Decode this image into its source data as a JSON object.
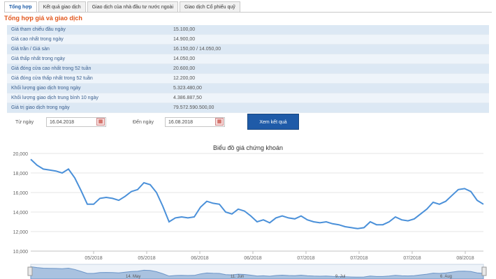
{
  "tabs": [
    {
      "label": "Tổng hợp",
      "active": true
    },
    {
      "label": "Kết quả giao dịch",
      "active": false
    },
    {
      "label": "Giao dịch của nhà đầu tư nước ngoài",
      "active": false
    },
    {
      "label": "Giao dịch Cổ phiếu quỹ",
      "active": false
    }
  ],
  "section_title": "Tổng hợp giá và giao dịch",
  "summary": [
    {
      "label": "Giá tham chiếu đầu ngày",
      "value": "15.100,00"
    },
    {
      "label": "Giá cao nhất trong ngày",
      "value": "14.900,00"
    },
    {
      "label": "Giá trần / Giá sàn",
      "value": "16.150,00 / 14.050,00"
    },
    {
      "label": "Giá thấp nhất trong ngày",
      "value": "14.050,00"
    },
    {
      "label": "Giá đóng cửa cao nhất trong 52 tuần",
      "value": "20.600,00"
    },
    {
      "label": "Giá đóng cửa thấp nhất trong 52 tuần",
      "value": "12.200,00"
    },
    {
      "label": "Khối lượng giao dịch trong ngày",
      "value": "5.323.480,00"
    },
    {
      "label": "Khối lượng giao dịch trung bình 10 ngày",
      "value": "4.386.887,50"
    },
    {
      "label": "Giá trị giao dịch trong ngày",
      "value": "79.572.590.500,00"
    }
  ],
  "filter": {
    "from_label": "Từ ngày",
    "from_value": "16.04.2018",
    "to_label": "Đến ngày",
    "to_value": "16.08.2018",
    "button_label": "Xem kết quả"
  },
  "colors": {
    "line": "#4a90d9",
    "accent": "#e2571d",
    "button": "#1f5ba8"
  },
  "chart_data": {
    "type": "line",
    "title": "Biểu đồ giá chứng khoán",
    "ylim": [
      10000,
      20000
    ],
    "y_ticks": [
      "20,000",
      "18,000",
      "16,000",
      "14,000",
      "12,000",
      "10,000"
    ],
    "x_ticks": [
      "05/2018",
      "05/2018",
      "06/2018",
      "06/2018",
      "07/2018",
      "07/2018",
      "07/2018",
      "08/2018"
    ],
    "navigator_labels": [
      "14. May",
      "11. Jun",
      "9. Jul",
      "6. Aug"
    ],
    "series": [
      {
        "values": [
          19400,
          18800,
          18400,
          18300,
          18200,
          18000,
          18400,
          17500,
          16200,
          14800,
          14800,
          15400,
          15500,
          15400,
          15200,
          15600,
          16100,
          16300,
          17000,
          16800,
          16000,
          14600,
          13000,
          13400,
          13500,
          13400,
          13500,
          14500,
          15100,
          14900,
          14800,
          14000,
          13800,
          14300,
          14100,
          13600,
          13000,
          13200,
          12900,
          13400,
          13600,
          13400,
          13300,
          13600,
          13200,
          13000,
          12900,
          13000,
          12800,
          12700,
          12500,
          12400,
          12300,
          12400,
          13000,
          12700,
          12700,
          13000,
          13500,
          13200,
          13100,
          13300,
          13800,
          14300,
          15000,
          14800,
          15100,
          15700,
          16300,
          16400,
          16100,
          15200,
          14800
        ]
      }
    ]
  }
}
